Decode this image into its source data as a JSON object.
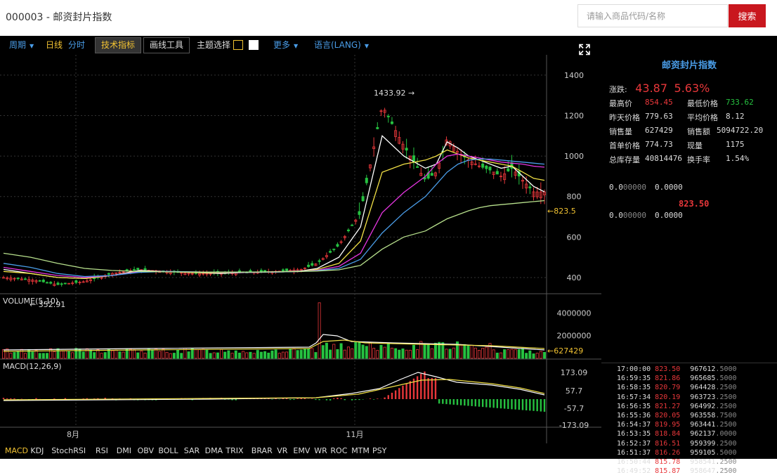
{
  "header": {
    "title": "000003 - 邮资封片指数",
    "search_placeholder": "请输入商品代码/名称",
    "search_label": "搜索"
  },
  "toolbar": {
    "period": "周期",
    "daily": "日线",
    "intraday": "分时",
    "indicators": "技术指标",
    "drawing": "画线工具",
    "theme": "主题选择",
    "more": "更多",
    "lang": "语言(LANG)",
    "fullscreen_icon": "expand-icon"
  },
  "colors": {
    "up": "#e8373a",
    "down": "#26c140",
    "accent_blue": "#4a9de8",
    "ma_white": "#ffffff",
    "ma_yellow": "#f1e046",
    "ma_magenta": "#e535e0",
    "ma_blue": "#4a9de8",
    "ma_green": "#b7e08c"
  },
  "quote": {
    "name": "邮资封片指数",
    "change_label": "涨跌:",
    "change_value": "43.87",
    "change_pct": "5.63%",
    "high_label": "最高价",
    "high": "854.45",
    "low_label": "最低价格",
    "low": "733.62",
    "prev_label": "昨天价格",
    "prev": "779.63",
    "avg_label": "平均价格",
    "avg": "8.12",
    "vol_label": "销售量",
    "vol": "627429",
    "amount_label": "销售额",
    "amount": "5094722.20",
    "first_label": "首单价格",
    "first": "774.73",
    "now_label": "现量",
    "now": "1175",
    "stock_label": "总库存量",
    "stock": "40814476",
    "turnover_label": "换手率",
    "turnover": "1.54%",
    "bid_price": "0.0",
    "bid_price_dec": "00000",
    "bid_vol": "0.0000",
    "ask_price": "0.0",
    "ask_price_dec": "00000",
    "ask_vol": "0.0000",
    "last": "823.50"
  },
  "trades": [
    {
      "time": "17:00:00",
      "price": "823.50",
      "vol": "967612",
      "dec": ".5000"
    },
    {
      "time": "16:59:35",
      "price": "821.86",
      "vol": "965685",
      "dec": ".5000"
    },
    {
      "time": "16:58:35",
      "price": "820.79",
      "vol": "964428",
      "dec": ".2500"
    },
    {
      "time": "16:57:34",
      "price": "820.19",
      "vol": "963723",
      "dec": ".2500"
    },
    {
      "time": "16:56:35",
      "price": "821.27",
      "vol": "964992",
      "dec": ".2500"
    },
    {
      "time": "16:55:36",
      "price": "820.05",
      "vol": "963558",
      "dec": ".7500"
    },
    {
      "time": "16:54:37",
      "price": "819.95",
      "vol": "963441",
      "dec": ".2500"
    },
    {
      "time": "16:53:35",
      "price": "818.84",
      "vol": "962137",
      "dec": ".0000"
    },
    {
      "time": "16:52:37",
      "price": "816.51",
      "vol": "959399",
      "dec": ".2500"
    },
    {
      "time": "16:51:37",
      "price": "816.26",
      "vol": "959105",
      "dec": ".5000"
    },
    {
      "time": "16:50:44",
      "price": "815.78",
      "vol": "958541",
      "dec": ".2500"
    },
    {
      "time": "16:49:52",
      "price": "815.87",
      "vol": "958647",
      "dec": ".2500"
    }
  ],
  "chart_data": [
    {
      "type": "line",
      "title": "",
      "y_ticks": [
        400,
        600,
        800,
        1000,
        1200,
        1400
      ],
      "x_ticks": [
        "8月",
        "11月"
      ],
      "max_label": "1433.92",
      "min_label": "352.91",
      "last_label": "823.5",
      "x": [
        0,
        5,
        10,
        15,
        20,
        25,
        30,
        35,
        40,
        45,
        50,
        55,
        58,
        62,
        66,
        70,
        74,
        78,
        80,
        82,
        84,
        86,
        88,
        90,
        92,
        94,
        96,
        98,
        100
      ],
      "series": [
        {
          "name": "close",
          "values": [
            400,
            390,
            365,
            380,
            420,
            440,
            430,
            420,
            420,
            425,
            430,
            440,
            470,
            560,
            720,
            1250,
            1050,
            880,
            920,
            1090,
            1020,
            980,
            950,
            930,
            900,
            940,
            880,
            823,
            823
          ]
        },
        {
          "name": "ma1",
          "values": [
            440,
            420,
            400,
            395,
            410,
            435,
            430,
            425,
            420,
            425,
            428,
            432,
            445,
            500,
            650,
            1100,
            1000,
            940,
            960,
            1070,
            1040,
            1000,
            980,
            960,
            940,
            950,
            900,
            850,
            823
          ]
        },
        {
          "name": "ma2",
          "values": [
            430,
            420,
            400,
            395,
            410,
            430,
            430,
            425,
            423,
            425,
            427,
            430,
            440,
            470,
            580,
            920,
            960,
            980,
            1000,
            1030,
            1010,
            990,
            980,
            970,
            960,
            950,
            920,
            890,
            880
          ]
        },
        {
          "name": "ma3",
          "values": [
            450,
            430,
            410,
            400,
            410,
            428,
            430,
            428,
            425,
            425,
            427,
            430,
            436,
            455,
            520,
            720,
            820,
            900,
            960,
            1000,
            1010,
            1000,
            990,
            980,
            970,
            965,
            960,
            950,
            945
          ]
        },
        {
          "name": "ma4",
          "values": [
            470,
            450,
            420,
            405,
            410,
            425,
            430,
            428,
            426,
            426,
            427,
            430,
            434,
            445,
            490,
            620,
            720,
            800,
            860,
            920,
            960,
            980,
            985,
            985,
            980,
            975,
            970,
            965,
            960
          ]
        },
        {
          "name": "ma5",
          "values": [
            520,
            500,
            470,
            445,
            435,
            430,
            428,
            427,
            427,
            427,
            428,
            430,
            432,
            438,
            460,
            540,
            600,
            630,
            660,
            690,
            710,
            730,
            745,
            755,
            760,
            765,
            770,
            775,
            780
          ]
        }
      ]
    },
    {
      "type": "bar",
      "title": "VOLUME(5,10)",
      "y_ticks": [
        2000000,
        4000000
      ],
      "last_label": "627429"
    },
    {
      "type": "bar",
      "title": "MACD(12,26,9)",
      "y_ticks": [
        "173.09",
        "57.7",
        "-57.7",
        "-173.09"
      ]
    }
  ],
  "indicators": [
    "MACD",
    "KDJ",
    "StochRSI",
    "RSI",
    "DMI",
    "OBV",
    "BOLL",
    "SAR",
    "DMA",
    "TRIX",
    "BRAR",
    "VR",
    "EMV",
    "WR",
    "ROC",
    "MTM",
    "PSY"
  ]
}
